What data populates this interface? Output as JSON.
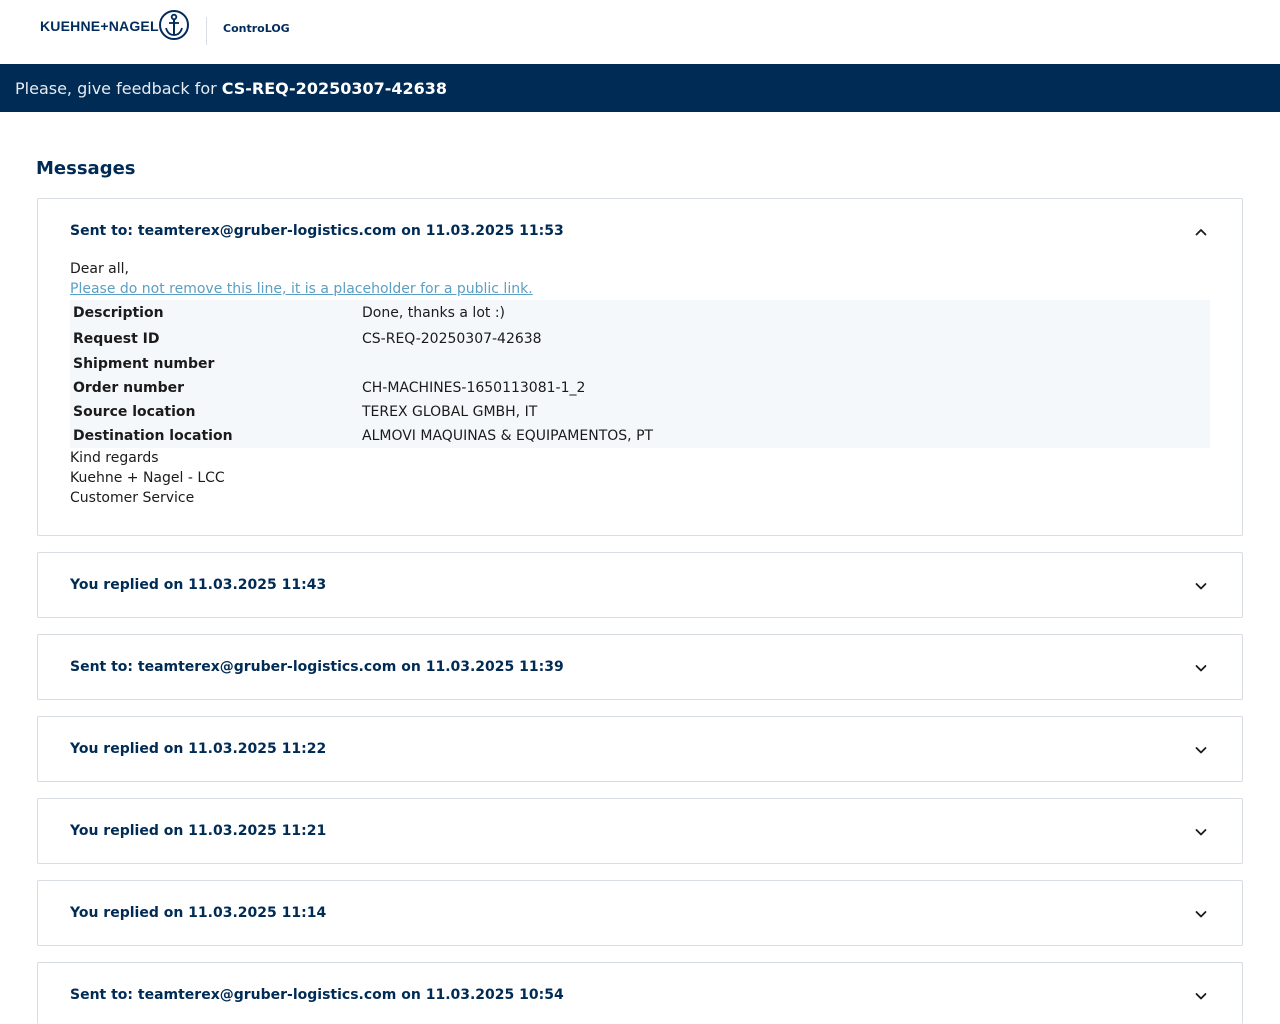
{
  "header": {
    "brand": "KUEHNE+NAGEL",
    "app_name": "ControLOG",
    "logo_icon": "anchor-icon"
  },
  "banner": {
    "prefix": "Please, give feedback for",
    "request_id": "CS-REQ-20250307-42638"
  },
  "messages": {
    "title": "Messages",
    "open": {
      "header": "Sent to: teamterex@gruber-logistics.com on 11.03.2025 11:53",
      "greeting": "Dear all,",
      "link": "Please do not remove this line, it is a placeholder for a public link.",
      "table": [
        {
          "key": "Description",
          "value": "Done, thanks a lot :)"
        },
        {
          "key": "Request ID",
          "value": "CS-REQ-20250307-42638"
        },
        {
          "key": "Shipment number",
          "value": ""
        },
        {
          "key": "Order number",
          "value": "CH-MACHINES-1650113081-1_2"
        },
        {
          "key": "Source location",
          "value": "TEREX GLOBAL GMBH, IT"
        },
        {
          "key": "Destination location",
          "value": "ALMOVI MAQUINAS & EQUIPAMENTOS, PT"
        }
      ],
      "signature": [
        "Kind regards",
        "Kuehne + Nagel - LCC",
        "Customer Service"
      ]
    },
    "collapsed": [
      {
        "header": "You replied on 11.03.2025 11:43"
      },
      {
        "header": "Sent to: teamterex@gruber-logistics.com on 11.03.2025 11:39"
      },
      {
        "header": "You replied on 11.03.2025 11:22"
      },
      {
        "header": "You replied on 11.03.2025 11:21"
      },
      {
        "header": "You replied on 11.03.2025 11:14"
      },
      {
        "header": "Sent to: teamterex@gruber-logistics.com on 11.03.2025 10:54"
      }
    ]
  }
}
